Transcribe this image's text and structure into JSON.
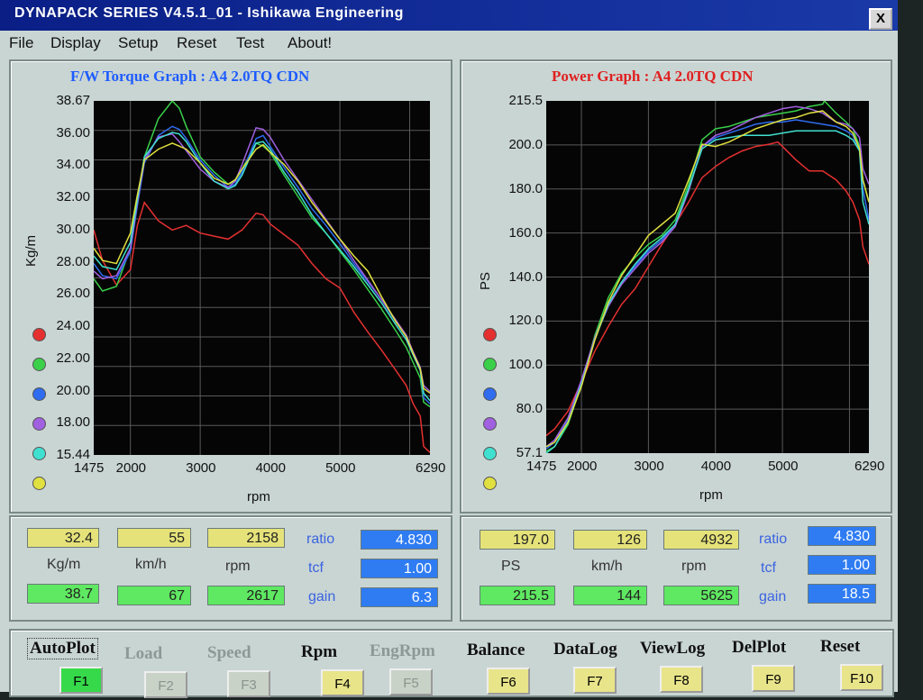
{
  "window": {
    "title": "DYNAPACK SERIES V4.5.1_01  - Ishikawa Engineering",
    "close_label": "X"
  },
  "menu": [
    "File",
    "Display",
    "Setup",
    "Reset",
    "Test",
    "About!"
  ],
  "torque_graph": {
    "title": "F/W Torque Graph : A4 2.0TQ CDN",
    "title_color": "#1e5cff",
    "y_ticks": [
      "38.67",
      "36.00",
      "34.00",
      "32.00",
      "30.00",
      "28.00",
      "26.00",
      "24.00",
      "22.00",
      "20.00",
      "18.00",
      "15.44"
    ],
    "x_ticks": [
      "1475",
      "2000",
      "3000",
      "4000",
      "5000",
      "6290"
    ],
    "ylabel": "Kg/m",
    "xlabel": "rpm"
  },
  "power_graph": {
    "title": "Power Graph : A4 2.0TQ CDN",
    "title_color": "#e02020",
    "y_ticks": [
      "215.5",
      "200.0",
      "180.0",
      "160.0",
      "140.0",
      "120.0",
      "100.0",
      "80.0",
      "57.1"
    ],
    "x_ticks": [
      "1475",
      "2000",
      "3000",
      "4000",
      "5000",
      "6290"
    ],
    "ylabel": "PS",
    "xlabel": "rpm"
  },
  "run_colors": [
    "#e53030",
    "#3ad04a",
    "#2f6cf0",
    "#a060e0",
    "#40e0d0",
    "#e0e040"
  ],
  "chart_data": [
    {
      "type": "line",
      "title": "F/W Torque Graph : A4 2.0TQ CDN",
      "xlabel": "rpm",
      "ylabel": "Kg/m",
      "xlim": [
        1475,
        6290
      ],
      "ylim": [
        15.44,
        38.67
      ],
      "grid": true,
      "series": [
        {
          "color": "#e53030",
          "x": [
            1475,
            1600,
            1800,
            2000,
            2100,
            2200,
            2400,
            2600,
            2800,
            3000,
            3200,
            3400,
            3600,
            3800,
            3900,
            4000,
            4200,
            4400,
            4600,
            4800,
            5000,
            5200,
            5400,
            5600,
            5800,
            5950,
            6050,
            6150,
            6200,
            6290
          ],
          "y": [
            30.2,
            28.2,
            26.6,
            27.6,
            30.5,
            32.0,
            30.8,
            30.2,
            30.5,
            30.0,
            29.8,
            29.6,
            30.2,
            31.3,
            31.2,
            30.6,
            29.9,
            29.2,
            28.0,
            27.0,
            26.4,
            24.8,
            23.5,
            22.3,
            21.0,
            20.0,
            18.8,
            18.0,
            16.0,
            15.6
          ]
        },
        {
          "color": "#3ad04a",
          "x": [
            1475,
            1600,
            1800,
            2000,
            2100,
            2200,
            2400,
            2600,
            2700,
            2800,
            3000,
            3200,
            3400,
            3500,
            3600,
            3800,
            3900,
            4000,
            4200,
            4400,
            4600,
            4800,
            5000,
            5200,
            5400,
            5600,
            5800,
            5950,
            6050,
            6150,
            6200,
            6290
          ],
          "y": [
            27.0,
            26.2,
            26.5,
            29.0,
            32.0,
            35.0,
            37.5,
            38.67,
            38.2,
            37.0,
            35.0,
            34.0,
            33.2,
            33.4,
            34.2,
            35.9,
            35.7,
            35.3,
            33.8,
            32.4,
            31.0,
            30.0,
            28.8,
            27.6,
            26.3,
            25.0,
            23.6,
            22.5,
            21.5,
            20.5,
            18.9,
            18.6
          ]
        },
        {
          "color": "#2f6cf0",
          "x": [
            1475,
            1600,
            1800,
            2000,
            2100,
            2200,
            2400,
            2600,
            2700,
            2800,
            3000,
            3200,
            3400,
            3500,
            3600,
            3800,
            3900,
            4000,
            4200,
            4400,
            4600,
            4800,
            5000,
            5200,
            5400,
            5600,
            5800,
            5950,
            6050,
            6150,
            6200,
            6290
          ],
          "y": [
            28.0,
            27.2,
            27.0,
            28.8,
            31.8,
            34.6,
            36.4,
            37.0,
            36.8,
            36.2,
            34.8,
            33.8,
            33.0,
            33.2,
            34.0,
            36.2,
            36.4,
            35.7,
            34.3,
            33.0,
            31.6,
            30.5,
            29.3,
            28.0,
            26.8,
            25.6,
            24.2,
            23.2,
            22.0,
            21.0,
            19.2,
            18.8
          ]
        },
        {
          "color": "#a060e0",
          "x": [
            1475,
            1600,
            1800,
            2000,
            2100,
            2200,
            2400,
            2600,
            2700,
            2800,
            3000,
            3200,
            3400,
            3500,
            3600,
            3800,
            3900,
            4000,
            4200,
            4400,
            4600,
            4800,
            5000,
            5200,
            5400,
            5600,
            5800,
            5950,
            6050,
            6150,
            6200,
            6290
          ],
          "y": [
            27.5,
            27.0,
            27.2,
            29.0,
            32.0,
            34.8,
            36.3,
            36.5,
            36.0,
            35.4,
            34.2,
            33.4,
            33.0,
            33.4,
            34.5,
            36.9,
            36.8,
            36.3,
            34.8,
            33.5,
            32.2,
            30.9,
            29.6,
            28.2,
            26.9,
            25.6,
            24.3,
            23.3,
            22.2,
            21.2,
            20.0,
            19.6
          ]
        },
        {
          "color": "#40e0d0",
          "x": [
            1475,
            1600,
            1800,
            2000,
            2100,
            2200,
            2400,
            2600,
            2700,
            2800,
            3000,
            3200,
            3400,
            3500,
            3600,
            3800,
            3900,
            4000,
            4200,
            4400,
            4600,
            4800,
            5000,
            5200,
            5400,
            5600,
            5800,
            5950,
            6050,
            6150,
            6200,
            6290
          ],
          "y": [
            28.5,
            27.8,
            27.6,
            29.4,
            32.2,
            35.0,
            36.2,
            36.6,
            36.5,
            36.0,
            34.6,
            33.4,
            32.9,
            33.1,
            33.8,
            35.9,
            36.0,
            35.5,
            34.0,
            32.7,
            31.2,
            30.0,
            28.9,
            27.8,
            26.6,
            25.4,
            24.0,
            23.0,
            22.0,
            21.0,
            19.5,
            19.0
          ]
        },
        {
          "color": "#e0e040",
          "x": [
            1475,
            1600,
            1800,
            2000,
            2100,
            2200,
            2400,
            2600,
            2700,
            2800,
            3000,
            3200,
            3400,
            3500,
            3600,
            3800,
            3900,
            4000,
            4200,
            4400,
            4600,
            4800,
            5000,
            5200,
            5400,
            5600,
            5800,
            5950,
            6050,
            6150,
            6200,
            6290
          ],
          "y": [
            29.0,
            28.2,
            28.0,
            30.0,
            32.5,
            34.8,
            35.5,
            35.9,
            35.7,
            35.5,
            34.6,
            33.6,
            33.2,
            33.5,
            34.2,
            35.5,
            35.8,
            35.3,
            34.5,
            33.4,
            32.0,
            30.8,
            29.6,
            28.5,
            27.5,
            25.8,
            24.2,
            23.2,
            22.1,
            21.1,
            19.8,
            19.5
          ]
        }
      ]
    },
    {
      "type": "line",
      "title": "Power Graph : A4 2.0TQ CDN",
      "xlabel": "rpm",
      "ylabel": "PS",
      "xlim": [
        1475,
        6290
      ],
      "ylim": [
        57.1,
        215.5
      ],
      "grid": true,
      "series": [
        {
          "color": "#e53030",
          "x": [
            1475,
            1600,
            1800,
            2000,
            2200,
            2400,
            2600,
            2800,
            3000,
            3200,
            3400,
            3600,
            3800,
            4000,
            4200,
            4400,
            4600,
            4800,
            4932,
            5000,
            5200,
            5400,
            5600,
            5800,
            5950,
            6050,
            6150,
            6200,
            6290
          ],
          "y": [
            65.0,
            68.0,
            76.0,
            89.0,
            103.0,
            114.0,
            124.0,
            131.0,
            141.0,
            151.0,
            160.0,
            170.0,
            181.0,
            186.0,
            190.0,
            193.0,
            195.0,
            196.0,
            197.0,
            195.0,
            189.0,
            184.0,
            184.0,
            180.0,
            175.0,
            170.0,
            162.0,
            150.0,
            142.0
          ]
        },
        {
          "color": "#3ad04a",
          "x": [
            1475,
            1600,
            1800,
            2000,
            2200,
            2400,
            2600,
            2800,
            3000,
            3200,
            3400,
            3600,
            3800,
            4000,
            4200,
            4400,
            4600,
            4800,
            5000,
            5200,
            5400,
            5600,
            5625,
            5800,
            5950,
            6050,
            6150,
            6200,
            6290
          ],
          "y": [
            58.0,
            60.0,
            70.0,
            88.0,
            110.0,
            127.0,
            138.0,
            145.0,
            151.0,
            155.0,
            162.0,
            178.0,
            198.0,
            203.0,
            204.0,
            206.0,
            208.0,
            209.0,
            210.0,
            211.0,
            213.0,
            214.0,
            215.5,
            210.0,
            206.0,
            203.0,
            195.0,
            180.0,
            170.0
          ]
        },
        {
          "color": "#2f6cf0",
          "x": [
            1475,
            1600,
            1800,
            2000,
            2200,
            2400,
            2600,
            2800,
            3000,
            3200,
            3400,
            3600,
            3800,
            4000,
            4200,
            4400,
            4600,
            4800,
            5000,
            5200,
            5400,
            5600,
            5800,
            5950,
            6050,
            6150,
            6200,
            6290
          ],
          "y": [
            59.0,
            62.0,
            72.0,
            89.0,
            109.0,
            124.0,
            134.0,
            141.0,
            148.0,
            153.0,
            160.0,
            176.0,
            195.0,
            199.0,
            201.0,
            203.0,
            205.0,
            206.0,
            206.0,
            207.0,
            206.0,
            205.0,
            204.0,
            202.0,
            200.0,
            193.0,
            176.0,
            162.0
          ]
        },
        {
          "color": "#a060e0",
          "x": [
            1475,
            1600,
            1800,
            2000,
            2200,
            2400,
            2600,
            2800,
            3000,
            3200,
            3400,
            3600,
            3800,
            4000,
            4200,
            4400,
            4600,
            4800,
            5000,
            5200,
            5400,
            5600,
            5800,
            5950,
            6050,
            6150,
            6200,
            6290
          ],
          "y": [
            60.0,
            63.0,
            73.0,
            90.0,
            109.0,
            123.0,
            133.0,
            140.0,
            147.0,
            152.0,
            159.0,
            175.0,
            195.0,
            200.0,
            202.0,
            205.0,
            208.0,
            210.0,
            212.0,
            213.0,
            212.0,
            210.0,
            206.0,
            205.0,
            203.0,
            199.0,
            185.0,
            178.0
          ]
        },
        {
          "color": "#40e0d0",
          "x": [
            1475,
            1600,
            1800,
            2000,
            2200,
            2400,
            2600,
            2800,
            3000,
            3200,
            3400,
            3600,
            3800,
            4000,
            4200,
            4400,
            4600,
            4800,
            5000,
            5200,
            5400,
            5600,
            5800,
            5950,
            6050,
            6150,
            6200,
            6290
          ],
          "y": [
            57.1,
            60.0,
            71.0,
            88.0,
            108.0,
            124.0,
            134.0,
            142.0,
            149.0,
            154.0,
            160.0,
            176.0,
            194.0,
            198.0,
            199.0,
            200.0,
            200.0,
            200.0,
            201.0,
            202.0,
            202.0,
            202.0,
            202.0,
            200.0,
            198.0,
            193.0,
            170.0,
            160.0
          ]
        },
        {
          "color": "#e0e040",
          "x": [
            1475,
            1600,
            1800,
            2000,
            2200,
            2400,
            2600,
            2800,
            3000,
            3200,
            3400,
            3600,
            3800,
            4000,
            4200,
            4400,
            4600,
            4800,
            5000,
            5200,
            5400,
            5600,
            5800,
            5950,
            6050,
            6150,
            6200,
            6290
          ],
          "y": [
            60.0,
            62.0,
            71.0,
            87.0,
            108.0,
            125.0,
            137.0,
            146.0,
            155.0,
            160.0,
            165.0,
            180.0,
            196.0,
            195.0,
            197.0,
            200.0,
            203.0,
            205.0,
            207.0,
            208.0,
            210.0,
            211.0,
            206.0,
            204.0,
            201.0,
            194.0,
            180.0,
            170.0
          ]
        }
      ]
    }
  ],
  "torque_readouts": {
    "row1": [
      "32.4",
      "55",
      "2158"
    ],
    "units": [
      "Kg/m",
      "km/h",
      "rpm"
    ],
    "row2": [
      "38.7",
      "67",
      "2617"
    ],
    "labels": [
      "ratio",
      "tcf",
      "gain"
    ],
    "values": [
      "4.830",
      "1.00",
      "6.3"
    ]
  },
  "power_readouts": {
    "row1": [
      "197.0",
      "126",
      "4932"
    ],
    "units": [
      "PS",
      "km/h",
      "rpm"
    ],
    "row2": [
      "215.5",
      "144",
      "5625"
    ],
    "labels": [
      "ratio",
      "tcf",
      "gain"
    ],
    "values": [
      "4.830",
      "1.00",
      "18.5"
    ]
  },
  "function_keys": [
    {
      "label": "AutoPlot",
      "key": "F1",
      "state": "active"
    },
    {
      "label": "Load",
      "key": "F2",
      "state": "disabled"
    },
    {
      "label": "Speed",
      "key": "F3",
      "state": "disabled"
    },
    {
      "label": "Rpm",
      "key": "F4",
      "state": "enabled"
    },
    {
      "label": "EngRpm",
      "key": "F5",
      "state": "disabled"
    },
    {
      "label": "Balance",
      "key": "F6",
      "state": "enabled"
    },
    {
      "label": "DataLog",
      "key": "F7",
      "state": "enabled"
    },
    {
      "label": "ViewLog",
      "key": "F8",
      "state": "enabled"
    },
    {
      "label": "DelPlot",
      "key": "F9",
      "state": "enabled"
    },
    {
      "label": "Reset",
      "key": "F10",
      "state": "enabled"
    }
  ]
}
